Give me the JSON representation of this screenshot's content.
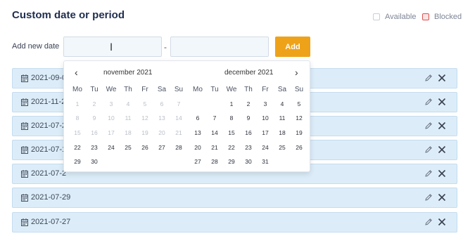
{
  "header": {
    "title": "Custom date or period",
    "legend_available": "Available",
    "legend_blocked": "Blocked",
    "blocked_color": "#d9534f"
  },
  "add_form": {
    "label": "Add new date",
    "from_value": "",
    "to_value": "",
    "separator": "-",
    "add_label": "Add",
    "add_color": "#eea21a"
  },
  "date_rows": [
    {
      "date": "2021-09-0"
    },
    {
      "date": "2021-11-2"
    },
    {
      "date": "2021-07-2"
    },
    {
      "date": "2021-07-1"
    },
    {
      "date": "2021-07-2"
    },
    {
      "date": "2021-07-29"
    },
    {
      "date": "2021-07-27"
    }
  ],
  "calendar": {
    "weekdays": [
      "Mo",
      "Tu",
      "We",
      "Th",
      "Fr",
      "Sa",
      "Su"
    ],
    "left": {
      "title": "november 2021",
      "cells": [
        {
          "d": "1",
          "dis": true
        },
        {
          "d": "2",
          "dis": true
        },
        {
          "d": "3",
          "dis": true
        },
        {
          "d": "4",
          "dis": true
        },
        {
          "d": "5",
          "dis": true
        },
        {
          "d": "6",
          "dis": true
        },
        {
          "d": "7",
          "dis": true
        },
        {
          "d": "8",
          "dis": true
        },
        {
          "d": "9",
          "dis": true
        },
        {
          "d": "10",
          "dis": true
        },
        {
          "d": "11",
          "dis": true
        },
        {
          "d": "12",
          "dis": true
        },
        {
          "d": "13",
          "dis": true
        },
        {
          "d": "14",
          "dis": true
        },
        {
          "d": "15",
          "dis": true
        },
        {
          "d": "16",
          "dis": true
        },
        {
          "d": "17",
          "dis": true
        },
        {
          "d": "18",
          "dis": true
        },
        {
          "d": "19",
          "dis": true
        },
        {
          "d": "20",
          "dis": true
        },
        {
          "d": "21",
          "dis": true
        },
        {
          "d": "22"
        },
        {
          "d": "23"
        },
        {
          "d": "24"
        },
        {
          "d": "25"
        },
        {
          "d": "26"
        },
        {
          "d": "27"
        },
        {
          "d": "28"
        },
        {
          "d": "29"
        },
        {
          "d": "30"
        }
      ]
    },
    "right": {
      "title": "december 2021",
      "cells": [
        {
          "d": ""
        },
        {
          "d": ""
        },
        {
          "d": "1"
        },
        {
          "d": "2"
        },
        {
          "d": "3"
        },
        {
          "d": "4"
        },
        {
          "d": "5"
        },
        {
          "d": "6"
        },
        {
          "d": "7"
        },
        {
          "d": "8"
        },
        {
          "d": "9"
        },
        {
          "d": "10"
        },
        {
          "d": "11"
        },
        {
          "d": "12"
        },
        {
          "d": "13"
        },
        {
          "d": "14"
        },
        {
          "d": "15"
        },
        {
          "d": "16"
        },
        {
          "d": "17"
        },
        {
          "d": "18"
        },
        {
          "d": "19"
        },
        {
          "d": "20"
        },
        {
          "d": "21"
        },
        {
          "d": "22"
        },
        {
          "d": "23"
        },
        {
          "d": "24"
        },
        {
          "d": "25"
        },
        {
          "d": "26"
        },
        {
          "d": "27"
        },
        {
          "d": "28"
        },
        {
          "d": "29"
        },
        {
          "d": "30"
        },
        {
          "d": "31"
        }
      ]
    },
    "prev_icon": "chevron-left-icon",
    "next_icon": "chevron-right-icon"
  },
  "icons": {
    "row_calendar": "calendar-icon",
    "row_edit": "pencil-icon",
    "row_delete": "close-icon",
    "cursor": "text-cursor-icon"
  }
}
